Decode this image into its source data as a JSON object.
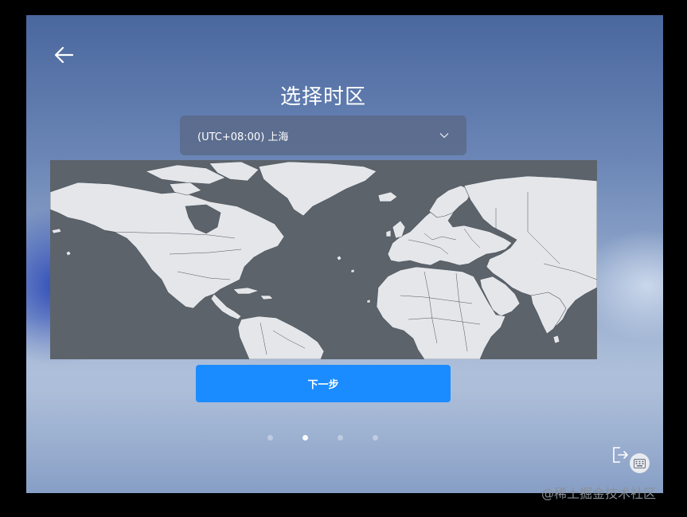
{
  "screen": {
    "title": "选择时区",
    "back_icon": "arrow-left-icon"
  },
  "timezone": {
    "selected": "(UTC+08:00) 上海",
    "chevron_icon": "chevron-down-icon"
  },
  "map": {
    "region": "world-map",
    "ocean_color": "#5c636b",
    "land_color": "#e4e6ea"
  },
  "actions": {
    "next_label": "下一步",
    "next_color": "#1a8cff"
  },
  "pager": {
    "total": 4,
    "current": 2
  },
  "corner": {
    "exit_icon": "exit-icon",
    "keyboard_icon": "keyboard-icon"
  },
  "watermark": {
    "text": "@稀土掘金技术社区"
  }
}
